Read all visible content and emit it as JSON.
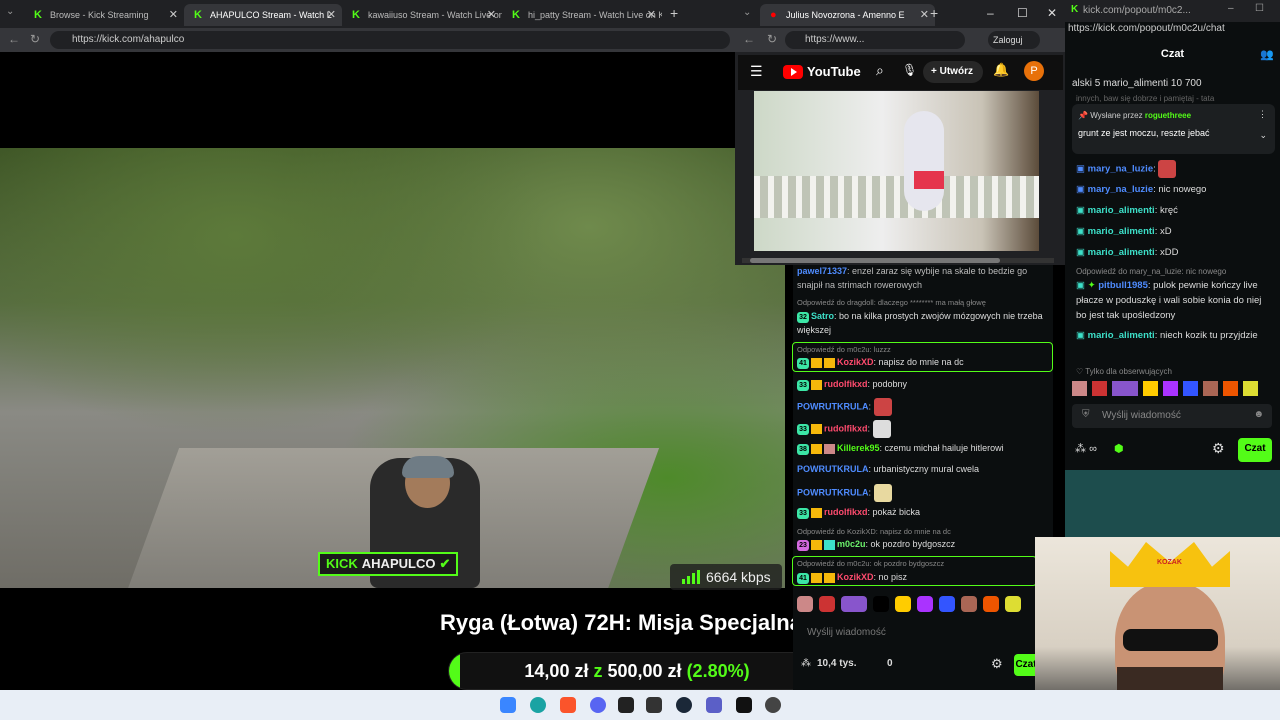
{
  "main_browser": {
    "tabs": [
      {
        "label": "Browse - Kick Streaming"
      },
      {
        "label": "AHAPULCO Stream - Watch L"
      },
      {
        "label": "kawaiiuso Stream - Watch Live on"
      },
      {
        "label": "hi_patty Stream - Watch Live on K"
      }
    ],
    "url": "https://kick.com/ahapulco"
  },
  "stream": {
    "channel_badge": "KICK",
    "channel_name": "AHAPULCO",
    "bitrate": "6664 kbps",
    "title": "Ryga (Łotwa) 72H: Misja Specjalna",
    "goal_current": "14,00 zł",
    "goal_sep": "z",
    "goal_target": "500,00 zł",
    "goal_percent_text": "(2.80%)",
    "goal_percent": 2.8
  },
  "yt_window": {
    "tab_title": "Julius Novozrona - Amenno E",
    "url": "https://www...",
    "login_label": "Zaloguj",
    "logo_text": "YouTube",
    "create_label": "Utwórz",
    "avatar_letter": "P"
  },
  "chat2": {
    "messages": [
      {
        "reply": "",
        "user": "pawel71337",
        "text": ": enzel zaraz się wybije na skale to bedzie go snajpił na strimach rowerowych"
      },
      {
        "reply": "Odpowiedź do dragdoll: dlaczego ******** ma małą głowę",
        "user": "Satro",
        "text": ": bo na kilka prostych zwojów mózgowych nie trzeba większej"
      },
      {
        "reply": "Odpowiedź do m0c2u: luzzz",
        "user": "KozikXD",
        "text": ": napisz do mnie na dc"
      },
      {
        "reply": "",
        "user": "rudolfikxd",
        "text": ": podobny"
      },
      {
        "reply": "",
        "user": "POWRUTKRULA",
        "text": ":"
      },
      {
        "reply": "",
        "user": "rudolfikxd",
        "text": ":"
      },
      {
        "reply": "",
        "user": "Killerek95",
        "text": ": czemu michał hailuje hitlerowi"
      },
      {
        "reply": "",
        "user": "POWRUTKRULA",
        "text": ": urbanistyczny mural cwela"
      },
      {
        "reply": "",
        "user": "POWRUTKRULA",
        "text": ":"
      },
      {
        "reply": "",
        "user": "rudolfikxd",
        "text": ": pokaż bicka"
      },
      {
        "reply": "Odpowiedź do KozikXD: napisz do mnie na dc",
        "user": "m0c2u",
        "text": ": ok pozdro bydgoszcz"
      },
      {
        "reply": "Odpowiedź do m0c2u: ok pozdro bydgoszcz",
        "user": "KozikXD",
        "text": ": no pisz"
      }
    ],
    "badges": {
      "b41": "41",
      "b33": "33",
      "b32": "32",
      "b38": "38",
      "b23": "23"
    },
    "input_placeholder": "Wyślij wiadomość",
    "viewers": "10,4 tys.",
    "zero": "0",
    "send_label": "Czat"
  },
  "popout": {
    "url": "https://kick.com/popout/m0c2u/chat",
    "tab_url": "kick.com/popout/m0c2...",
    "header": "Czat",
    "top_gifters": "alski 5   mario_alimenti 10   700",
    "pinned_by": "Wysłane przez",
    "pinned_user": "roguethreee",
    "pinned_text": "grunt ze jest moczu, reszte jebać",
    "top_cut": "innych, baw się dobrze i pamiętaj - tata",
    "messages": [
      {
        "reply": "",
        "user": "mary_na_luzie",
        "text": ":"
      },
      {
        "reply": "",
        "user": "mary_na_luzie",
        "text": ": nic nowego"
      },
      {
        "reply": "",
        "user": "mario_alimenti",
        "text": ": kręć"
      },
      {
        "reply": "",
        "user": "mario_alimenti",
        "text": ": xD"
      },
      {
        "reply": "",
        "user": "mario_alimenti",
        "text": ": xDD"
      },
      {
        "reply": "Odpowiedź do mary_na_luzie: nic nowego",
        "user": "pitbull1985",
        "text": ": pulok pewnie kończy live płacze w poduszkę i wali sobie konia do niej bo jest tak upośledzony"
      },
      {
        "reply": "",
        "user": "mario_alimenti",
        "text": ": niech kozik tu przyjdzie"
      }
    ],
    "followers_only": "Tylko dla obserwujących",
    "input_placeholder": "Wyślij wiadomość",
    "infinity": "∞",
    "send_label": "Czat"
  },
  "webcam": {
    "hat_text": "KOZAK"
  },
  "colors": {
    "kick_green": "#53fc18",
    "chat_bg": "#0b0e0f"
  }
}
